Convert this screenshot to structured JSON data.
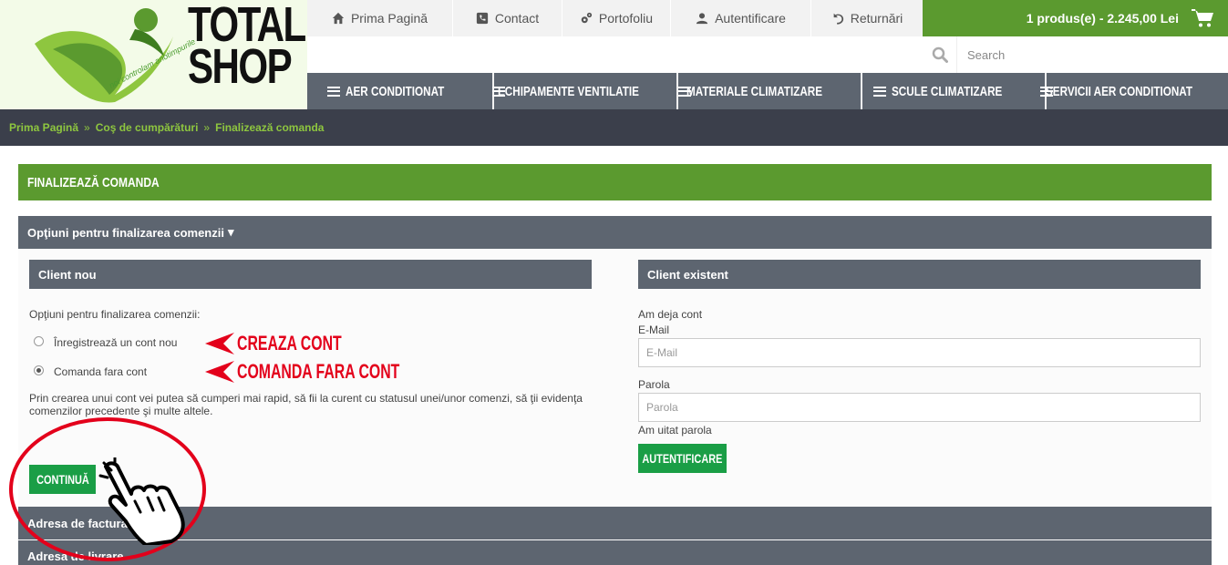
{
  "brand": {
    "line1": "TOTAL",
    "line2": "SHOP",
    "tagline": "noi controlam anotimpurile"
  },
  "topnav": {
    "items": [
      {
        "label": "Prima Pagină",
        "icon": "home-icon"
      },
      {
        "label": "Contact",
        "icon": "phone-icon"
      },
      {
        "label": "Portofoliu",
        "icon": "gears-icon"
      },
      {
        "label": "Autentificare",
        "icon": "user-icon"
      },
      {
        "label": "Returnări",
        "icon": "undo-icon"
      }
    ]
  },
  "cart": {
    "label": "1 produs(e) - 2.245,00 Lei",
    "icon": "cart-icon"
  },
  "search": {
    "placeholder": "Search",
    "icon": "search-icon"
  },
  "mainnav": {
    "items": [
      {
        "label": "AER CONDITIONAT"
      },
      {
        "label": "ECHIPAMENTE VENTILATIE"
      },
      {
        "label": "MATERIALE CLIMATIZARE"
      },
      {
        "label": "SCULE CLIMATIZARE"
      },
      {
        "label": "SERVICII AER CONDITIONAT"
      }
    ]
  },
  "breadcrumb": {
    "items": [
      "Prima Pagină",
      "Coş de cumpărături",
      "Finalizează comanda"
    ],
    "separator": "»"
  },
  "page": {
    "title": "FINALIZEAZĂ COMANDA",
    "options_heading": "Opţiuni pentru finalizarea comenzii",
    "options_caret": "▾"
  },
  "new_client": {
    "heading": "Client nou",
    "prompt": "Opţiuni pentru finalizarea comenzii:",
    "option_register": "Înregistrează un cont nou",
    "option_guest": "Comanda fara cont",
    "selected": "guest",
    "description": "Prin crearea unui cont vei putea să cumperi mai rapid, să fii la curent cu statusul unei/unor comenzi, să ţii evidenţa comenzilor precedente şi multe altele.",
    "continue_label": "CONTINUĂ"
  },
  "existing_client": {
    "heading": "Client existent",
    "intro": "Am deja cont",
    "email_label": "E-Mail",
    "email_placeholder": "E-Mail",
    "password_label": "Parola",
    "password_placeholder": "Parola",
    "forgot": "Am uitat parola",
    "login_label": "AUTENTIFICARE"
  },
  "annotations": {
    "create_account": "CREAZA CONT",
    "guest_order": "COMANDA FARA CONT",
    "color": "#e3001b"
  },
  "collapsed_sections": {
    "billing": "Adresa de facturare",
    "shipping": "Adresa de livrare"
  },
  "colors": {
    "brand_green": "#5b9a2f",
    "button_green": "#1a9e46",
    "nav_gray": "#5d6570",
    "breadcrumb_bg": "#3b3f4b",
    "breadcrumb_link": "#8ec63f"
  }
}
